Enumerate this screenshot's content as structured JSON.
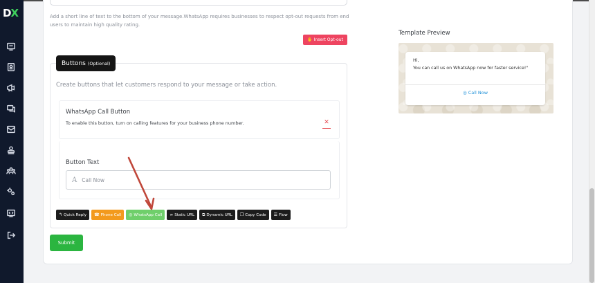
{
  "sidebar": {
    "logo_d": "D",
    "logo_x": "X",
    "icons": [
      "chat-window-icon",
      "contact-book-icon",
      "megaphone-icon",
      "messages-icon",
      "mail-icon",
      "users-stack-icon",
      "team-icon",
      "settings-gears-icon",
      "monitor-code-icon",
      "logout-icon"
    ]
  },
  "footer_section": {
    "help_text": "Add a short line of text to the bottom of your message.WhatsApp requires businesses to respect opt-out requests from end users to maintain high quality rating.",
    "insert_optout_label": "Insert Opt-out"
  },
  "buttons_section": {
    "title": "Buttons",
    "title_suffix": "(Optional)",
    "description": "Create buttons that let customers respond to your message or take action.",
    "whatsapp_call": {
      "title": "WhatsApp Call Button",
      "subtitle": "To enable this button, turn on calling features for your business phone number.",
      "close_symbol": "✕"
    },
    "button_text": {
      "label": "Button Text",
      "placeholder": "Call Now",
      "value": ""
    },
    "type_buttons": [
      {
        "label": "Quick Reply",
        "icon": "↰",
        "style": "dark"
      },
      {
        "label": "Phone Call",
        "icon": "☎",
        "style": "orange"
      },
      {
        "label": "WhatsApp Call",
        "icon": "◎",
        "style": "green"
      },
      {
        "label": "Static URL",
        "icon": "∞",
        "style": "dark"
      },
      {
        "label": "Dynamic URL",
        "icon": "⧉",
        "style": "dark"
      },
      {
        "label": "Copy Code",
        "icon": "❐",
        "style": "dark"
      },
      {
        "label": "Flow",
        "icon": "☰",
        "style": "dark"
      }
    ]
  },
  "submit_label": "Submit",
  "template_preview": {
    "title": "Template Preview",
    "greeting": "Hi,",
    "message": "You can call us on WhatsApp now for faster service!\"",
    "call_button": "Call Now"
  },
  "colors": {
    "sidebar_bg": "#10192c",
    "brand_green": "#3ecf5c",
    "optout_red": "#ee4460",
    "submit_green": "#2bb540",
    "arrow": "#c0473a",
    "link_blue": "#1e90d8"
  }
}
